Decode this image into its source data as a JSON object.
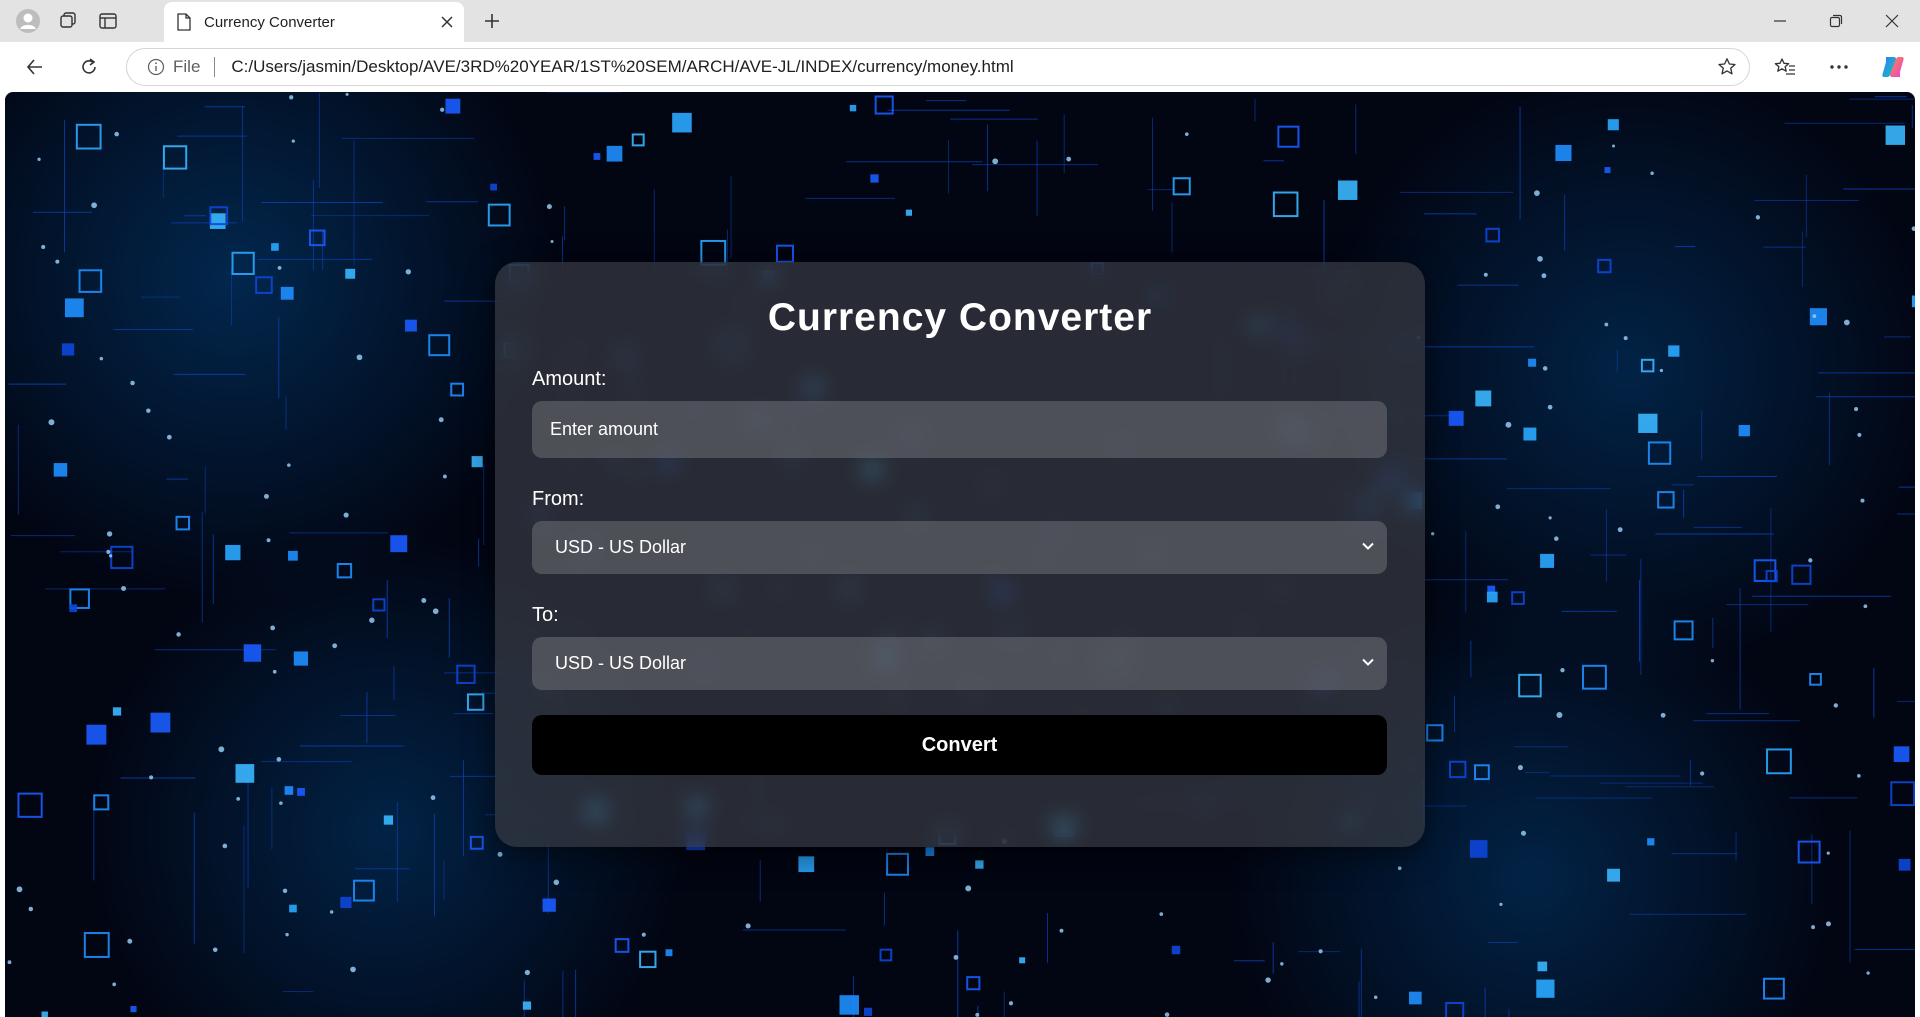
{
  "browser": {
    "tab": {
      "title": "Currency Converter"
    },
    "address": {
      "scheme_label": "File",
      "url": "C:/Users/jasmin/Desktop/AVE/3RD%20YEAR/1ST%20SEM/ARCH/AVE-JL/INDEX/currency/money.html"
    }
  },
  "converter": {
    "heading": "Currency Converter",
    "amount_label": "Amount:",
    "amount_placeholder": "Enter amount",
    "amount_value": "",
    "from_label": "From:",
    "from_selected": "USD - US Dollar",
    "to_label": "To:",
    "to_selected": "USD - US Dollar",
    "convert_label": "Convert"
  },
  "colors": {
    "accent_blue": "#1e8fff",
    "card_bg": "#373a42",
    "button_bg": "#000000"
  }
}
